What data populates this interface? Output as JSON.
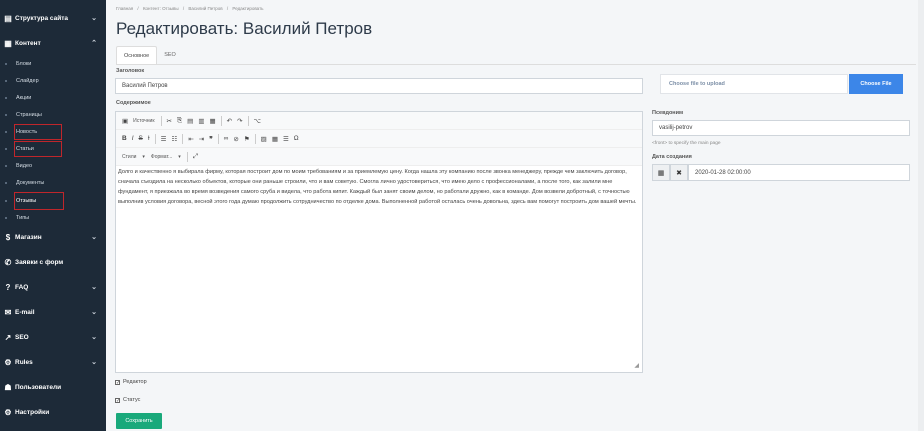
{
  "sidebar": {
    "items": [
      {
        "label": "Структура сайта",
        "icon": "sitemap-icon",
        "glyph": "▤",
        "chevron": "⌄"
      },
      {
        "label": "Контент",
        "icon": "document-icon",
        "glyph": "▦",
        "chevron": "⌃"
      },
      {
        "label": "Магазин",
        "icon": "dollar-icon",
        "glyph": "$",
        "chevron": "⌄"
      },
      {
        "label": "Заявки с форм",
        "icon": "phone-icon",
        "glyph": "✆",
        "chevron": ""
      },
      {
        "label": "FAQ",
        "icon": "question-icon",
        "glyph": "?",
        "chevron": "⌄"
      },
      {
        "label": "E-mail",
        "icon": "envelope-icon",
        "glyph": "✉",
        "chevron": "⌄"
      },
      {
        "label": "SEO",
        "icon": "chart-line-icon",
        "glyph": "↗",
        "chevron": "⌄"
      },
      {
        "label": "Rules",
        "icon": "gears-icon",
        "glyph": "⚙",
        "chevron": "⌄"
      },
      {
        "label": "Пользователи",
        "icon": "users-icon",
        "glyph": "☗",
        "chevron": ""
      },
      {
        "label": "Настройки",
        "icon": "settings-icon",
        "glyph": "⚙",
        "chevron": ""
      }
    ],
    "content_sub": [
      "Блоки",
      "Слайдер",
      "Акции",
      "Страницы",
      "Новость",
      "Статьи",
      "Видео",
      "Документы",
      "Отзывы",
      "Типы"
    ]
  },
  "breadcrumbs": [
    "Главная",
    "/",
    "Контент: Отзывы",
    "/",
    "Василий Петров",
    "/",
    "Редактировать"
  ],
  "page_title": "Редактировать: Василий Петров",
  "tabs": [
    "Основное",
    "SEO"
  ],
  "form": {
    "title_label": "Заголовок",
    "title_value": "Василий Петров",
    "content_label": "Содержимое",
    "file_placeholder": "Choose file to upload",
    "file_button": "Choose File",
    "alias_label": "Псевдоним",
    "alias_value": "vasilij-petrov",
    "alias_hint": "<front> to specify the main page",
    "date_label": "Дата создания",
    "date_value": "2020-01-28 02:00:00",
    "editor_checkbox": "Редактор",
    "status_checkbox": "Статус",
    "save_button": "Сохранить"
  },
  "editor": {
    "source_label": "Источник",
    "styles_label": "Стили",
    "format_label": "Формат...",
    "text": "Долго и качественно я выбирала фирму, которая построит дом по моим требованиям и за приемлемую цену. Когда нашла эту компанию после звонка менеджеру, прежде чем заключить договор, сначала съездила на несколько объектов, которые они раньше строили, что и вам советую. Смогла лично удостовериться, что имею дело с профессионалами, а после того, как залили мне фундамент, я приезжала во время возведения самого сруба и видела, что работа кипит. Каждый был занят своим делом, но работали дружно, как в команде. Дом возвели добротный, с точностью выполнив условия договора, весной этого года думаю продолжить сотрудничество по отделке дома. Выполненной работой осталась очень довольна, здесь вам помогут построить дом вашей мечты."
  }
}
